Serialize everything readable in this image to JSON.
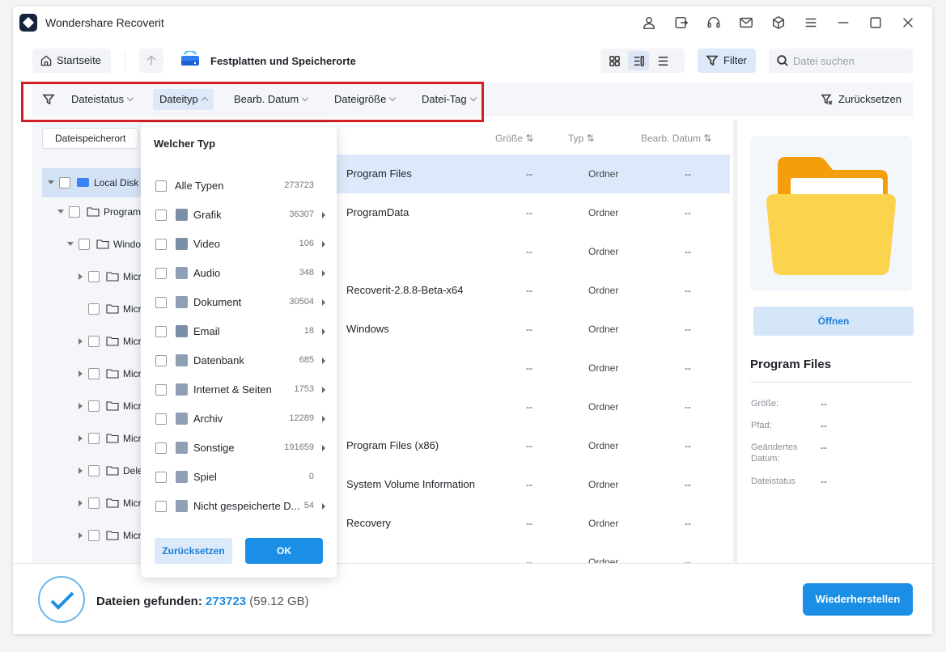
{
  "window": {
    "title": "Wondershare Recoverit"
  },
  "titlebar_icons": [
    "account-icon",
    "export-icon",
    "headset-icon",
    "mail-icon",
    "cube-icon",
    "menu-icon",
    "minimize-icon",
    "maximize-icon",
    "close-icon"
  ],
  "nav": {
    "home_label": "Startseite",
    "location_title": "Festplatten und Speicherorte",
    "filter_label": "Filter",
    "search_placeholder": "Datei suchen"
  },
  "filterbar": {
    "items": [
      "Dateistatus",
      "Dateityp",
      "Bearb. Datum",
      "Dateigröße",
      "Datei-Tag"
    ],
    "open_item": "Dateityp",
    "reset_label": "Zurücksetzen"
  },
  "tree": {
    "tab_label": "Dateispeicherort",
    "rows": [
      {
        "label": "Local Disk (C:)"
      },
      {
        "label": "Program Files"
      },
      {
        "label": "WindowsApps"
      },
      {
        "label": "Microsoft"
      },
      {
        "label": "Microsoft"
      },
      {
        "label": "Microsoft"
      },
      {
        "label": "Microsoft"
      },
      {
        "label": "Microsoft"
      },
      {
        "label": "Microsoft"
      },
      {
        "label": "Deleted"
      },
      {
        "label": "Microsoft"
      },
      {
        "label": "Microsoft"
      }
    ]
  },
  "list": {
    "columns": {
      "size": "Größe",
      "type": "Typ",
      "date": "Bearb. Datum"
    },
    "rows": [
      {
        "name": "Program Files",
        "size": "--",
        "type": "Ordner",
        "date": "--"
      },
      {
        "name": "ProgramData",
        "size": "--",
        "type": "Ordner",
        "date": "--"
      },
      {
        "name": "",
        "size": "--",
        "type": "Ordner",
        "date": "--"
      },
      {
        "name": "Recoverit-2.8.8-Beta-x64",
        "size": "--",
        "type": "Ordner",
        "date": "--"
      },
      {
        "name": "Windows",
        "size": "--",
        "type": "Ordner",
        "date": "--"
      },
      {
        "name": "",
        "size": "--",
        "type": "Ordner",
        "date": "--"
      },
      {
        "name": "",
        "size": "--",
        "type": "Ordner",
        "date": "--"
      },
      {
        "name": "Program Files (x86)",
        "size": "--",
        "type": "Ordner",
        "date": "--"
      },
      {
        "name": "System Volume Information",
        "size": "--",
        "type": "Ordner",
        "date": "--"
      },
      {
        "name": "Recovery",
        "size": "--",
        "type": "Ordner",
        "date": "--"
      },
      {
        "name": "",
        "size": "--",
        "type": "Ordner",
        "date": "--"
      }
    ]
  },
  "side": {
    "open_label": "Öffnen",
    "title": "Program Files",
    "props": [
      {
        "label": "Größe:",
        "value": "--"
      },
      {
        "label": "Pfad:",
        "value": "--"
      },
      {
        "label": "Geändertes Datum:",
        "value": "--"
      },
      {
        "label": "Dateistatus",
        "value": "--"
      }
    ]
  },
  "dropdown": {
    "title": "Welcher Typ",
    "items": [
      {
        "label": "Alle Typen",
        "count": "273723",
        "icon": "",
        "arrow": false
      },
      {
        "label": "Grafik",
        "count": "36307",
        "icon": "image-icon",
        "arrow": true
      },
      {
        "label": "Video",
        "count": "106",
        "icon": "video-icon",
        "arrow": true
      },
      {
        "label": "Audio",
        "count": "348",
        "icon": "audio-icon",
        "arrow": true
      },
      {
        "label": "Dokument",
        "count": "30504",
        "icon": "document-icon",
        "arrow": true
      },
      {
        "label": "Email",
        "count": "18",
        "icon": "email-icon",
        "arrow": true
      },
      {
        "label": "Datenbank",
        "count": "685",
        "icon": "database-icon",
        "arrow": true
      },
      {
        "label": "Internet & Seiten",
        "count": "1753",
        "icon": "internet-icon",
        "arrow": true
      },
      {
        "label": "Archiv",
        "count": "12289",
        "icon": "archive-icon",
        "arrow": true
      },
      {
        "label": "Sonstige",
        "count": "191659",
        "icon": "other-icon",
        "arrow": true
      },
      {
        "label": "Spiel",
        "count": "0",
        "icon": "game-icon",
        "arrow": false
      },
      {
        "label": "Nicht gespeicherte D...",
        "count": "54",
        "icon": "unsaved-icon",
        "arrow": true
      }
    ],
    "reset_label": "Zurücksetzen",
    "ok_label": "OK"
  },
  "status": {
    "found_label": "Dateien gefunden:",
    "found_count": "273723",
    "found_size": "(59.12 GB)",
    "recover_label": "Wiederherstellen"
  },
  "colors": {
    "accent": "#1b8fe6",
    "highlight_border": "#d32027",
    "folder": "#fbbf24"
  }
}
